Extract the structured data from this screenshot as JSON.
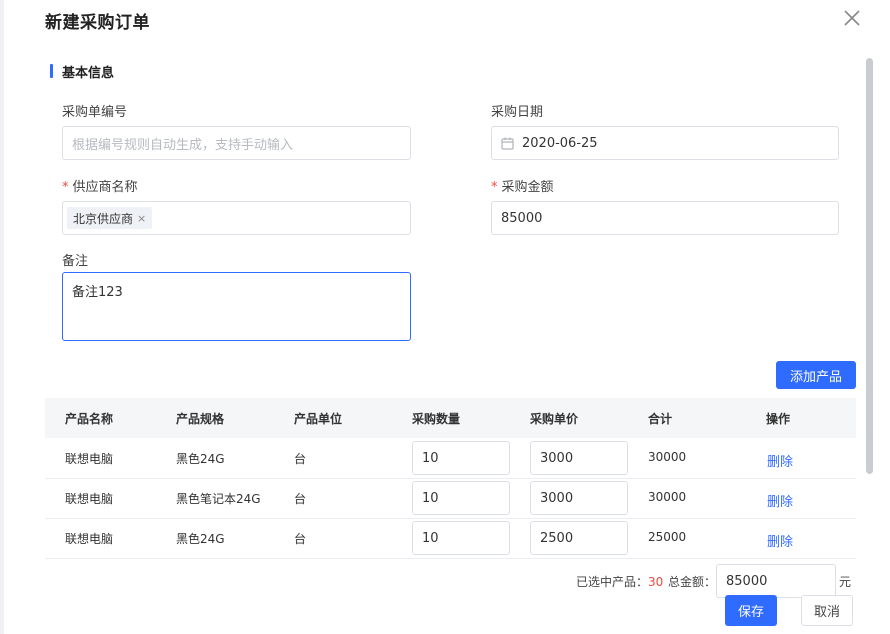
{
  "dialog": {
    "title": "新建采购订单"
  },
  "section": {
    "title": "基本信息"
  },
  "form": {
    "order_no": {
      "label": "采购单编号",
      "placeholder": "根据编号规则自动生成，支持手动输入"
    },
    "order_date": {
      "label": "采购日期",
      "value": "2020-06-25"
    },
    "supplier": {
      "label": "供应商名称",
      "required_mark": "*",
      "tag": "北京供应商",
      "tag_close": "×"
    },
    "amount": {
      "label": "采购金额",
      "required_mark": "*",
      "value": "85000"
    },
    "remark": {
      "label": "备注",
      "value": "备注123"
    }
  },
  "add_product_button": "添加产品",
  "table": {
    "headers": [
      "产品名称",
      "产品规格",
      "产品单位",
      "采购数量",
      "采购单价",
      "合计",
      "操作"
    ],
    "rows": [
      {
        "name": "联想电脑",
        "spec": "黑色24G",
        "unit": "台",
        "qty": "10",
        "price": "3000",
        "total": "30000",
        "action": "删除"
      },
      {
        "name": "联想电脑",
        "spec": "黑色笔记本24G",
        "unit": "台",
        "qty": "10",
        "price": "3000",
        "total": "30000",
        "action": "删除"
      },
      {
        "name": "联想电脑",
        "spec": "黑色24G",
        "unit": "台",
        "qty": "10",
        "price": "2500",
        "total": "25000",
        "action": "删除"
      }
    ]
  },
  "summary": {
    "selected_label": "已选中产品：",
    "selected_count": "30",
    "total_label": "总金额：",
    "total_value": "85000",
    "unit": "元"
  },
  "footer": {
    "save": "保存",
    "cancel": "取消"
  },
  "colors": {
    "primary": "#2f6bff",
    "required": "#f0483e"
  },
  "icons": {
    "close": "close-icon",
    "date": "calendar-icon"
  }
}
